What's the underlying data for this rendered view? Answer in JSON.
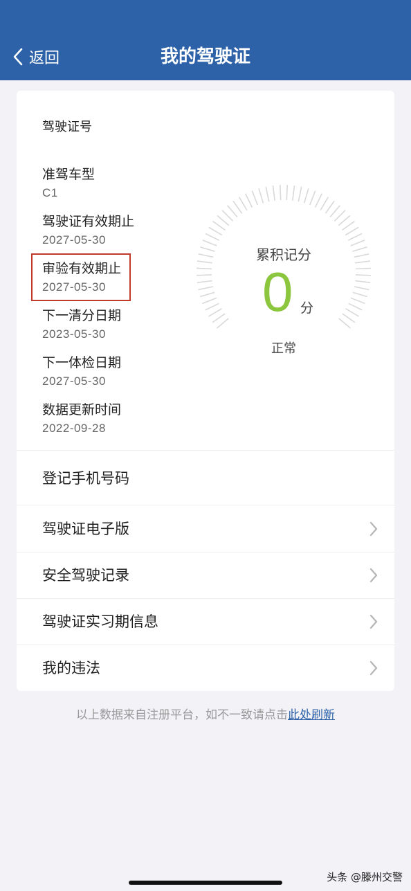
{
  "header": {
    "back_label": "返回",
    "title": "我的驾驶证",
    "bg_color": "#2d62a8"
  },
  "license": {
    "number_label": "驾驶证号",
    "fields": [
      {
        "label": "准驾车型",
        "value": "C1"
      },
      {
        "label": "驾驶证有效期止",
        "value": "2027-05-30"
      },
      {
        "label": "审验有效期止",
        "value": "2027-05-30"
      },
      {
        "label": "下一清分日期",
        "value": "2023-05-30"
      },
      {
        "label": "下一体检日期",
        "value": "2027-05-30"
      },
      {
        "label": "数据更新时间",
        "value": "2022-09-28"
      }
    ],
    "highlighted_field": "审验有效期止"
  },
  "score": {
    "title": "累积记分",
    "value": "0",
    "unit": "分",
    "status": "正常",
    "value_color": "#8cc63f"
  },
  "menu": [
    {
      "label": "登记手机号码",
      "has_chevron": false
    },
    {
      "label": "驾驶证电子版",
      "has_chevron": true
    },
    {
      "label": "安全驾驶记录",
      "has_chevron": true
    },
    {
      "label": "驾驶证实习期信息",
      "has_chevron": true
    },
    {
      "label": "我的违法",
      "has_chevron": true
    }
  ],
  "footnote": {
    "text": "以上数据来自注册平台，如不一致请点击",
    "link": "此处刷新"
  },
  "watermark": "头条 @滕州交警"
}
